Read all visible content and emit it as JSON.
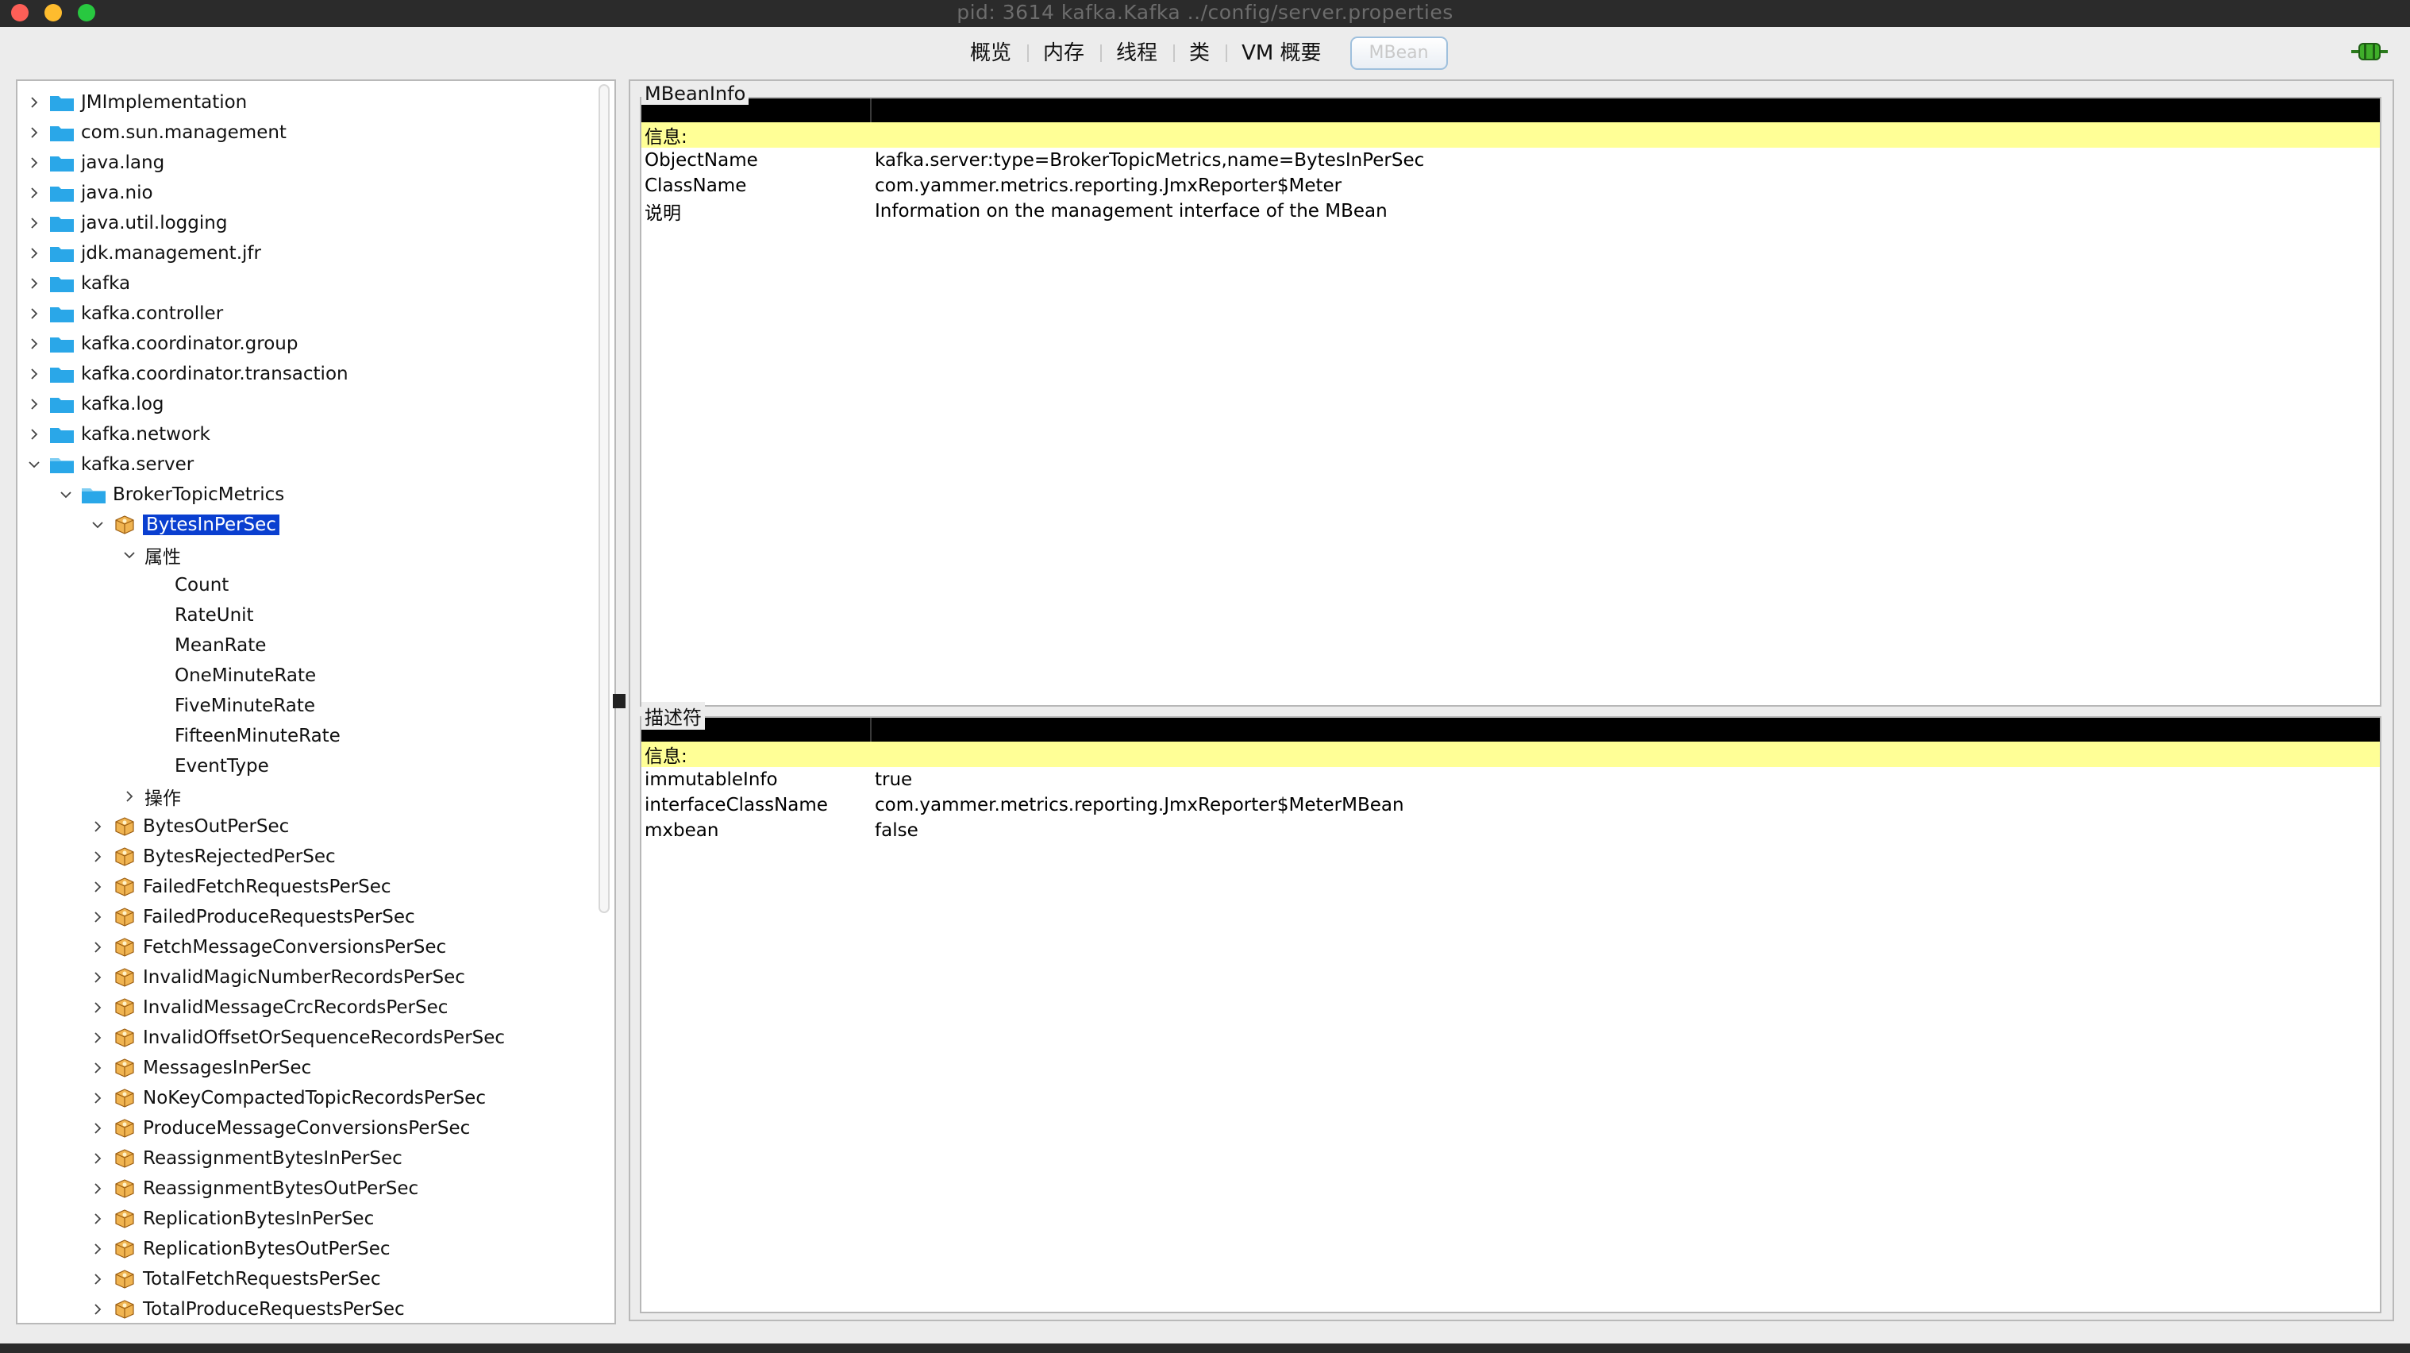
{
  "window": {
    "title": "pid: 3614 kafka.Kafka ../config/server.properties"
  },
  "tabs": [
    {
      "label": "概览",
      "active": false
    },
    {
      "label": "内存",
      "active": false
    },
    {
      "label": "线程",
      "active": false
    },
    {
      "label": "类",
      "active": false
    },
    {
      "label": "VM 概要",
      "active": false
    },
    {
      "label": "MBean",
      "active": true
    }
  ],
  "connection_icon": "connected-plug-icon",
  "tree": [
    {
      "label": "JMImplementation",
      "level": 0,
      "kind": "folder",
      "expanded": false
    },
    {
      "label": "com.sun.management",
      "level": 0,
      "kind": "folder",
      "expanded": false
    },
    {
      "label": "java.lang",
      "level": 0,
      "kind": "folder",
      "expanded": false
    },
    {
      "label": "java.nio",
      "level": 0,
      "kind": "folder",
      "expanded": false
    },
    {
      "label": "java.util.logging",
      "level": 0,
      "kind": "folder",
      "expanded": false
    },
    {
      "label": "jdk.management.jfr",
      "level": 0,
      "kind": "folder",
      "expanded": false
    },
    {
      "label": "kafka",
      "level": 0,
      "kind": "folder",
      "expanded": false
    },
    {
      "label": "kafka.controller",
      "level": 0,
      "kind": "folder",
      "expanded": false
    },
    {
      "label": "kafka.coordinator.group",
      "level": 0,
      "kind": "folder",
      "expanded": false
    },
    {
      "label": "kafka.coordinator.transaction",
      "level": 0,
      "kind": "folder",
      "expanded": false
    },
    {
      "label": "kafka.log",
      "level": 0,
      "kind": "folder",
      "expanded": false
    },
    {
      "label": "kafka.network",
      "level": 0,
      "kind": "folder",
      "expanded": false
    },
    {
      "label": "kafka.server",
      "level": 0,
      "kind": "folder-open",
      "expanded": true
    },
    {
      "label": "BrokerTopicMetrics",
      "level": 1,
      "kind": "folder-open",
      "expanded": true
    },
    {
      "label": "BytesInPerSec",
      "level": 2,
      "kind": "bean",
      "expanded": true,
      "selected": true
    },
    {
      "label": "属性",
      "level": 3,
      "kind": "none",
      "expanded": true
    },
    {
      "label": "Count",
      "level": 4,
      "kind": "leaf"
    },
    {
      "label": "RateUnit",
      "level": 4,
      "kind": "leaf"
    },
    {
      "label": "MeanRate",
      "level": 4,
      "kind": "leaf"
    },
    {
      "label": "OneMinuteRate",
      "level": 4,
      "kind": "leaf"
    },
    {
      "label": "FiveMinuteRate",
      "level": 4,
      "kind": "leaf"
    },
    {
      "label": "FifteenMinuteRate",
      "level": 4,
      "kind": "leaf"
    },
    {
      "label": "EventType",
      "level": 4,
      "kind": "leaf"
    },
    {
      "label": "操作",
      "level": 3,
      "kind": "none",
      "expanded": false
    },
    {
      "label": "BytesOutPerSec",
      "level": 2,
      "kind": "bean",
      "expanded": false
    },
    {
      "label": "BytesRejectedPerSec",
      "level": 2,
      "kind": "bean",
      "expanded": false
    },
    {
      "label": "FailedFetchRequestsPerSec",
      "level": 2,
      "kind": "bean",
      "expanded": false
    },
    {
      "label": "FailedProduceRequestsPerSec",
      "level": 2,
      "kind": "bean",
      "expanded": false
    },
    {
      "label": "FetchMessageConversionsPerSec",
      "level": 2,
      "kind": "bean",
      "expanded": false
    },
    {
      "label": "InvalidMagicNumberRecordsPerSec",
      "level": 2,
      "kind": "bean",
      "expanded": false
    },
    {
      "label": "InvalidMessageCrcRecordsPerSec",
      "level": 2,
      "kind": "bean",
      "expanded": false
    },
    {
      "label": "InvalidOffsetOrSequenceRecordsPerSec",
      "level": 2,
      "kind": "bean",
      "expanded": false
    },
    {
      "label": "MessagesInPerSec",
      "level": 2,
      "kind": "bean",
      "expanded": false
    },
    {
      "label": "NoKeyCompactedTopicRecordsPerSec",
      "level": 2,
      "kind": "bean",
      "expanded": false
    },
    {
      "label": "ProduceMessageConversionsPerSec",
      "level": 2,
      "kind": "bean",
      "expanded": false
    },
    {
      "label": "ReassignmentBytesInPerSec",
      "level": 2,
      "kind": "bean",
      "expanded": false
    },
    {
      "label": "ReassignmentBytesOutPerSec",
      "level": 2,
      "kind": "bean",
      "expanded": false
    },
    {
      "label": "ReplicationBytesInPerSec",
      "level": 2,
      "kind": "bean",
      "expanded": false
    },
    {
      "label": "ReplicationBytesOutPerSec",
      "level": 2,
      "kind": "bean",
      "expanded": false
    },
    {
      "label": "TotalFetchRequestsPerSec",
      "level": 2,
      "kind": "bean",
      "expanded": false
    },
    {
      "label": "TotalProduceRequestsPerSec",
      "level": 2,
      "kind": "bean",
      "expanded": false
    }
  ],
  "mbean_info": {
    "title": "MBeanInfo",
    "info_label": "信息:",
    "rows": [
      {
        "key": "ObjectName",
        "value": "kafka.server:type=BrokerTopicMetrics,name=BytesInPerSec"
      },
      {
        "key": "ClassName",
        "value": "com.yammer.metrics.reporting.JmxReporter$Meter"
      },
      {
        "key": "说明",
        "value": "Information on the management interface of the MBean"
      }
    ]
  },
  "descriptor": {
    "title": "描述符",
    "info_label": "信息:",
    "rows": [
      {
        "key": "immutableInfo",
        "value": "true"
      },
      {
        "key": "interfaceClassName",
        "value": "com.yammer.metrics.reporting.JmxReporter$MeterMBean"
      },
      {
        "key": "mxbean",
        "value": "false"
      }
    ]
  },
  "colors": {
    "selection": "#0a3fd0",
    "info_row": "#ffff96",
    "folder": "#2aa7e8",
    "bean": "#e8a23a"
  }
}
